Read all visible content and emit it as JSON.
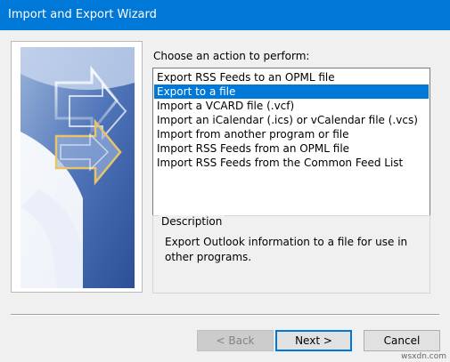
{
  "window": {
    "title": "Import and Export Wizard"
  },
  "main": {
    "prompt": "Choose an action to perform:",
    "actions": [
      {
        "label": "Export RSS Feeds to an OPML file",
        "selected": false
      },
      {
        "label": "Export to a file",
        "selected": true
      },
      {
        "label": "Import a VCARD file (.vcf)",
        "selected": false
      },
      {
        "label": "Import an iCalendar (.ics) or vCalendar file (.vcs)",
        "selected": false
      },
      {
        "label": "Import from another program or file",
        "selected": false
      },
      {
        "label": "Import RSS Feeds from an OPML file",
        "selected": false
      },
      {
        "label": "Import RSS Feeds from the Common Feed List",
        "selected": false
      }
    ],
    "description": {
      "legend": "Description",
      "text": "Export Outlook information to a file for use in other programs."
    }
  },
  "buttons": {
    "back": "< Back",
    "next": "Next >",
    "cancel": "Cancel"
  },
  "watermark": "wsxdn.com",
  "colors": {
    "accent": "#0078d7",
    "dialog_bg": "#f0f0f0"
  },
  "icons": {
    "wizard_art": "wizard-arrows-art"
  }
}
